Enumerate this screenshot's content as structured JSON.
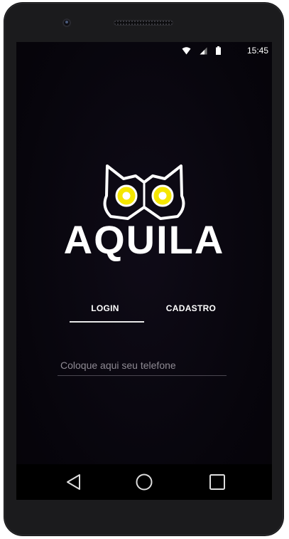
{
  "status_bar": {
    "time": "15:45",
    "icons": [
      "wifi-icon",
      "cellular-signal-icon",
      "battery-icon"
    ]
  },
  "brand": {
    "name": "AQUILA",
    "logo_icon": "owl-logo-icon",
    "eye_color": "#f5e600"
  },
  "tabs": [
    {
      "label": "LOGIN",
      "active": true
    },
    {
      "label": "CADASTRO",
      "active": false
    }
  ],
  "phone_input": {
    "placeholder": "Coloque aqui seu telefone",
    "value": ""
  },
  "nav_bar": {
    "buttons": [
      "back-icon",
      "home-icon",
      "recents-icon"
    ]
  },
  "colors": {
    "background": "#07050c",
    "text": "#ffffff",
    "accent": "#f5e600"
  }
}
